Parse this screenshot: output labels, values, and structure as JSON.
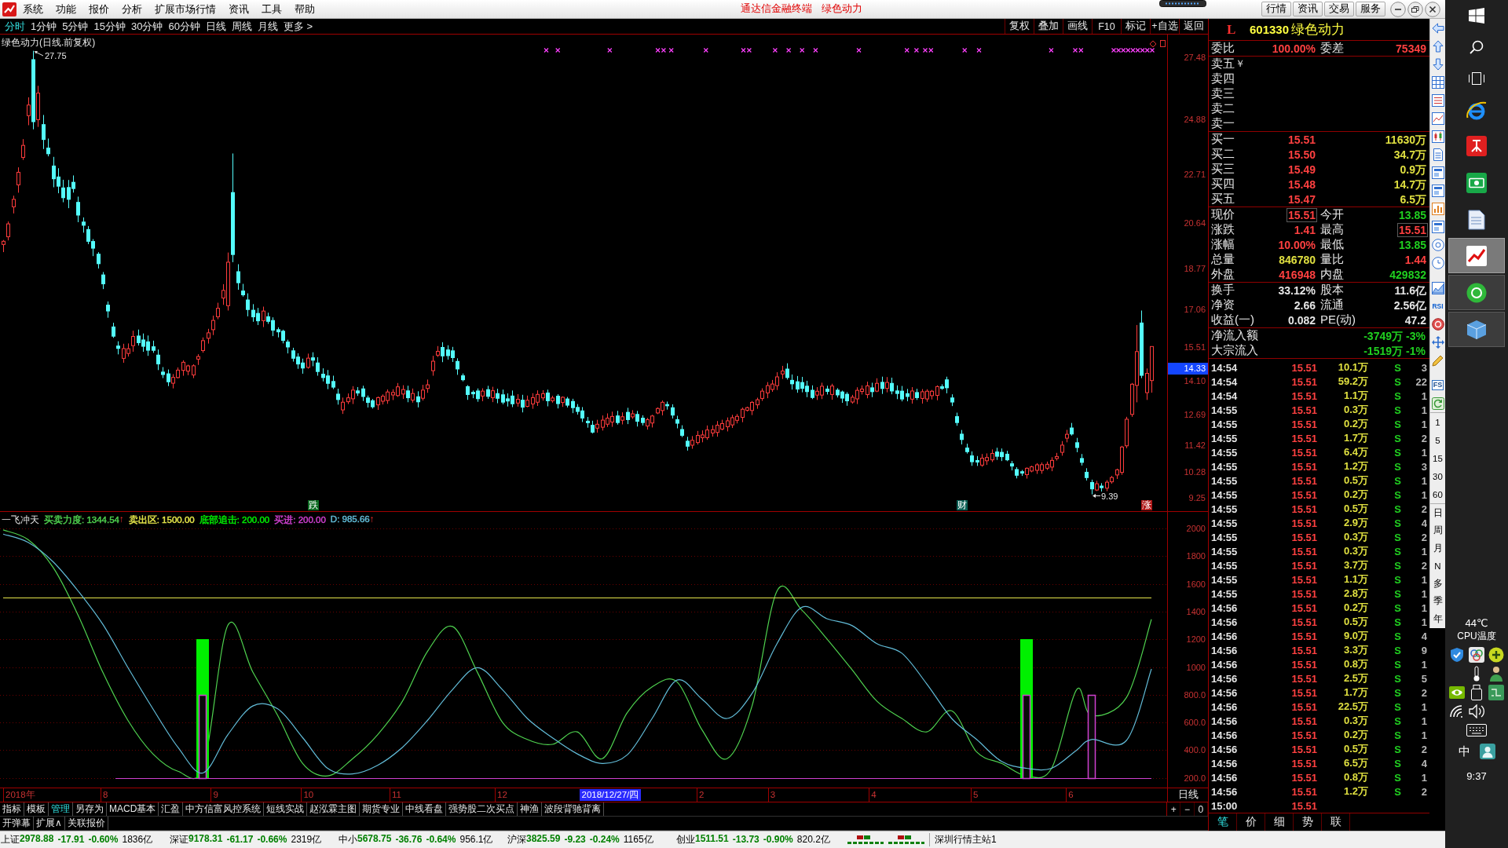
{
  "title_bar": {
    "menus": [
      "系统",
      "功能",
      "报价",
      "分析",
      "扩展市场行情",
      "资讯",
      "工具",
      "帮助"
    ],
    "caption": "通达信金融终端",
    "document": "绿色动力",
    "buttons": [
      "行情",
      "资讯",
      "交易",
      "服务"
    ]
  },
  "period_tabs": [
    {
      "label": "分时",
      "selected": true
    },
    {
      "label": "1分钟",
      "selected": false
    },
    {
      "label": "5分钟",
      "selected": false
    },
    {
      "label": "15分钟",
      "selected": false
    },
    {
      "label": "30分钟",
      "selected": false
    },
    {
      "label": "60分钟",
      "selected": false
    },
    {
      "label": "日线",
      "selected": false
    },
    {
      "label": "周线",
      "selected": false
    },
    {
      "label": "月线",
      "selected": false
    },
    {
      "label": "更多 >",
      "selected": false
    }
  ],
  "chart_tools": [
    "复权",
    "叠加",
    "画线",
    "F10",
    "标记",
    "+自选",
    "返回"
  ],
  "price_chart": {
    "title": "绿色动力(日线.前复权)",
    "high_label": "27.75",
    "low_label": "9.39",
    "axis_labels": [
      "27.48",
      "24.88",
      "22.71",
      "20.64",
      "18.77",
      "17.06",
      "15.51",
      "14.10",
      "12.69",
      "11.42",
      "10.28",
      "9.25"
    ],
    "cursor_price": "14.33",
    "markers": [
      {
        "label": "跌",
        "kind": "fall"
      },
      {
        "label": "财",
        "kind": "finance"
      },
      {
        "label": "涨",
        "kind": "rise"
      }
    ]
  },
  "indicator": {
    "name": "一飞冲天",
    "legend": [
      {
        "text": "买卖力度: 1344.54",
        "arrow": "↑",
        "color": "#4fd24f"
      },
      {
        "text": "卖出区: 1500.00",
        "color": "#e6e64a"
      },
      {
        "text": "底部追击: 200.00",
        "color": "#00f000"
      },
      {
        "text": "买进: 200.00",
        "color": "#d040d0"
      },
      {
        "text": "D: 985.66",
        "arrow": "↑",
        "color": "#62bcd8"
      }
    ],
    "axis_labels": [
      "2000",
      "1800",
      "1600",
      "1400",
      "1200",
      "1000",
      "800.0",
      "600.0",
      "400.0",
      "200.0"
    ]
  },
  "time_axis": {
    "labels": [
      "2018年",
      "8",
      "9",
      "10",
      "11",
      "12",
      "2",
      "3",
      "4",
      "5",
      "6"
    ],
    "cursor": "2018/12/27/四",
    "period": "日线"
  },
  "zoom_buttons": [
    "+",
    "−",
    "0"
  ],
  "formula_tabs": [
    {
      "label": "指标",
      "selected": false
    },
    {
      "label": "模板",
      "selected": false
    },
    {
      "label": "管理",
      "selected": true
    },
    {
      "label": "另存为",
      "selected": false
    },
    {
      "label": "MACD基本",
      "selected": false
    },
    {
      "label": "汇盈",
      "selected": false
    },
    {
      "label": "中方信富风控系统",
      "selected": false
    },
    {
      "label": "短线实战",
      "selected": false
    },
    {
      "label": "赵泓霖主图",
      "selected": false
    },
    {
      "label": "期货专业",
      "selected": false
    },
    {
      "label": "中线看盘",
      "selected": false
    },
    {
      "label": "强势股二次买点",
      "selected": false
    },
    {
      "label": "神渔",
      "selected": false
    },
    {
      "label": "波段背驰背离",
      "selected": false
    }
  ],
  "extra_tabs": [
    "开弹幕",
    "扩展∧",
    "关联报价"
  ],
  "quote": {
    "flag": "L",
    "code": "601330",
    "name": "绿色动力",
    "order_book_summary": [
      {
        "label": "委比",
        "value": "100.00%",
        "color": "#ff4040"
      },
      {
        "label": "委差",
        "value": "75349",
        "color": "#ff4040"
      }
    ],
    "asks": [
      {
        "label": "卖五",
        "badge": "￥"
      },
      {
        "label": "卖四"
      },
      {
        "label": "卖三"
      },
      {
        "label": "卖二"
      },
      {
        "label": "卖一"
      }
    ],
    "bids": [
      {
        "label": "买一",
        "price": "15.51",
        "volume": "11630万"
      },
      {
        "label": "买二",
        "price": "15.50",
        "volume": "34.7万"
      },
      {
        "label": "买三",
        "price": "15.49",
        "volume": "0.9万"
      },
      {
        "label": "买四",
        "price": "15.48",
        "volume": "14.7万"
      },
      {
        "label": "买五",
        "price": "15.47",
        "volume": "6.5万"
      }
    ],
    "stats": [
      {
        "label": "现价",
        "value": "15.51",
        "color": "#ff4040",
        "boxed": true
      },
      {
        "label": "今开",
        "value": "13.85",
        "color": "#20d020",
        "boxed": false
      },
      {
        "label": "涨跌",
        "value": "1.41",
        "color": "#ff4040",
        "boxed": false
      },
      {
        "label": "最高",
        "value": "15.51",
        "color": "#ff4040",
        "boxed": true
      },
      {
        "label": "涨幅",
        "value": "10.00%",
        "color": "#ff4040",
        "boxed": false
      },
      {
        "label": "最低",
        "value": "13.85",
        "color": "#20d020",
        "boxed": false
      },
      {
        "label": "总量",
        "value": "846780",
        "color": "#e0e040",
        "boxed": false
      },
      {
        "label": "量比",
        "value": "1.44",
        "color": "#ff4040",
        "boxed": false
      },
      {
        "label": "外盘",
        "value": "416948",
        "color": "#ff4040",
        "boxed": false
      },
      {
        "label": "内盘",
        "value": "429832",
        "color": "#20d020",
        "boxed": false
      }
    ],
    "fundamentals": [
      {
        "label": "换手",
        "value": "33.12%"
      },
      {
        "label": "股本",
        "value": "11.6亿"
      },
      {
        "label": "净资",
        "value": "2.66"
      },
      {
        "label": "流通",
        "value": "2.56亿"
      },
      {
        "label": "收益(一)",
        "value": "0.082"
      },
      {
        "label": "PE(动)",
        "value": "47.2"
      }
    ],
    "fund_flows": [
      {
        "label": "净流入额",
        "amount": "-3749万",
        "percent": "-3%"
      },
      {
        "label": "大宗流入",
        "amount": "-1519万",
        "percent": "-1%"
      }
    ]
  },
  "ticks": [
    {
      "time": "14:54",
      "price": "15.51",
      "volume": "10.1万",
      "side": "S",
      "count": "3"
    },
    {
      "time": "14:54",
      "price": "15.51",
      "volume": "59.2万",
      "side": "S",
      "count": "22"
    },
    {
      "time": "14:54",
      "price": "15.51",
      "volume": "1.1万",
      "side": "S",
      "count": "1"
    },
    {
      "time": "14:55",
      "price": "15.51",
      "volume": "0.3万",
      "side": "S",
      "count": "1"
    },
    {
      "time": "14:55",
      "price": "15.51",
      "volume": "0.2万",
      "side": "S",
      "count": "1"
    },
    {
      "time": "14:55",
      "price": "15.51",
      "volume": "1.7万",
      "side": "S",
      "count": "2"
    },
    {
      "time": "14:55",
      "price": "15.51",
      "volume": "6.4万",
      "side": "S",
      "count": "1"
    },
    {
      "time": "14:55",
      "price": "15.51",
      "volume": "1.2万",
      "side": "S",
      "count": "3"
    },
    {
      "time": "14:55",
      "price": "15.51",
      "volume": "0.5万",
      "side": "S",
      "count": "1"
    },
    {
      "time": "14:55",
      "price": "15.51",
      "volume": "0.2万",
      "side": "S",
      "count": "1"
    },
    {
      "time": "14:55",
      "price": "15.51",
      "volume": "0.5万",
      "side": "S",
      "count": "2"
    },
    {
      "time": "14:55",
      "price": "15.51",
      "volume": "2.9万",
      "side": "S",
      "count": "4"
    },
    {
      "time": "14:55",
      "price": "15.51",
      "volume": "0.3万",
      "side": "S",
      "count": "2"
    },
    {
      "time": "14:55",
      "price": "15.51",
      "volume": "0.3万",
      "side": "S",
      "count": "1"
    },
    {
      "time": "14:55",
      "price": "15.51",
      "volume": "3.7万",
      "side": "S",
      "count": "2"
    },
    {
      "time": "14:55",
      "price": "15.51",
      "volume": "1.1万",
      "side": "S",
      "count": "1"
    },
    {
      "time": "14:55",
      "price": "15.51",
      "volume": "2.8万",
      "side": "S",
      "count": "1"
    },
    {
      "time": "14:56",
      "price": "15.51",
      "volume": "0.2万",
      "side": "S",
      "count": "1"
    },
    {
      "time": "14:56",
      "price": "15.51",
      "volume": "0.5万",
      "side": "S",
      "count": "1"
    },
    {
      "time": "14:56",
      "price": "15.51",
      "volume": "9.0万",
      "side": "S",
      "count": "4"
    },
    {
      "time": "14:56",
      "price": "15.51",
      "volume": "3.3万",
      "side": "S",
      "count": "9"
    },
    {
      "time": "14:56",
      "price": "15.51",
      "volume": "0.8万",
      "side": "S",
      "count": "1"
    },
    {
      "time": "14:56",
      "price": "15.51",
      "volume": "2.5万",
      "side": "S",
      "count": "5"
    },
    {
      "time": "14:56",
      "price": "15.51",
      "volume": "1.7万",
      "side": "S",
      "count": "2"
    },
    {
      "time": "14:56",
      "price": "15.51",
      "volume": "22.5万",
      "side": "S",
      "count": "1"
    },
    {
      "time": "14:56",
      "price": "15.51",
      "volume": "0.3万",
      "side": "S",
      "count": "1"
    },
    {
      "time": "14:56",
      "price": "15.51",
      "volume": "0.2万",
      "side": "S",
      "count": "1"
    },
    {
      "time": "14:56",
      "price": "15.51",
      "volume": "0.5万",
      "side": "S",
      "count": "2"
    },
    {
      "time": "14:56",
      "price": "15.51",
      "volume": "6.5万",
      "side": "S",
      "count": "4"
    },
    {
      "time": "14:56",
      "price": "15.51",
      "volume": "0.8万",
      "side": "S",
      "count": "1"
    },
    {
      "time": "14:56",
      "price": "15.51",
      "volume": "1.2万",
      "side": "S",
      "count": "2"
    },
    {
      "time": "15:00",
      "price": "15.51"
    }
  ],
  "tick_tabs": [
    {
      "label": "笔",
      "selected": true
    },
    {
      "label": "价",
      "selected": false
    },
    {
      "label": "细",
      "selected": false
    },
    {
      "label": "势",
      "selected": false
    },
    {
      "label": "联",
      "selected": false
    }
  ],
  "tool_strip": {
    "text_tools": [
      "RSI",
      "FS"
    ],
    "periods": [
      "1",
      "5",
      "15",
      "30",
      "60"
    ],
    "cycles": [
      "日",
      "周",
      "月",
      "N",
      "多",
      "季",
      "年"
    ]
  },
  "status_bar": {
    "indices": [
      {
        "name": "上证",
        "value": "2978.88",
        "change": "-17.91",
        "percent": "-0.60%",
        "amount": "1836亿"
      },
      {
        "name": "深证",
        "value": "9178.31",
        "change": "-61.17",
        "percent": "-0.66%",
        "amount": "2319亿"
      },
      {
        "name": "中小",
        "value": "5678.75",
        "change": "-36.76",
        "percent": "-0.64%",
        "amount": "956.1亿"
      },
      {
        "name": "沪深",
        "value": "3825.59",
        "change": "-9.23",
        "percent": "-0.24%",
        "amount": "1165亿"
      },
      {
        "name": "创业",
        "value": "1511.51",
        "change": "-13.73",
        "percent": "-0.90%",
        "amount": "820.2亿"
      }
    ],
    "server": "深圳行情主站1"
  },
  "taskbar": {
    "apps": [
      {
        "open": false,
        "selected": false
      },
      {
        "open": false,
        "selected": false
      },
      {
        "open": false,
        "selected": false
      },
      {
        "open": false,
        "selected": false
      },
      {
        "open": true,
        "selected": true
      },
      {
        "open": true,
        "selected": false
      },
      {
        "open": true,
        "selected": false
      }
    ],
    "temperature": "44℃",
    "sensor": "CPU温度",
    "ime": "中",
    "clock": "9:37"
  }
}
